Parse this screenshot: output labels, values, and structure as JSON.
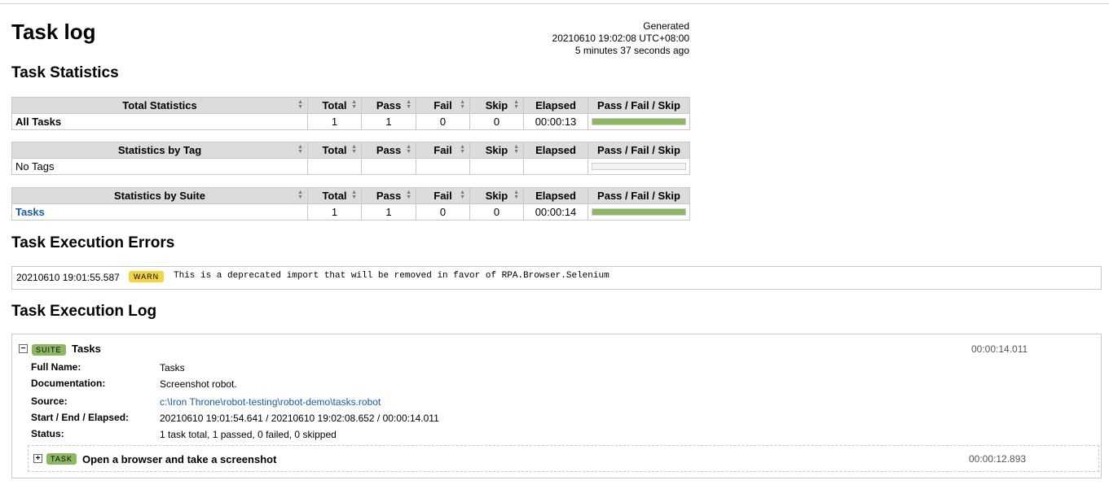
{
  "page": {
    "title": "Task log",
    "generated_label": "Generated",
    "generated_time": "20210610 19:02:08 UTC+08:00",
    "generated_ago": "5 minutes 37 seconds ago"
  },
  "statistics": {
    "title": "Task Statistics",
    "columns": [
      "Total",
      "Pass",
      "Fail",
      "Skip",
      "Elapsed",
      "Pass / Fail / Skip"
    ],
    "total": {
      "header": "Total Statistics",
      "row": {
        "name": "All Tasks",
        "total": "1",
        "pass": "1",
        "fail": "0",
        "skip": "0",
        "elapsed": "00:00:13",
        "pass_fraction": 1
      }
    },
    "tag": {
      "header": "Statistics by Tag",
      "row": {
        "name": "No Tags",
        "total": "",
        "pass": "",
        "fail": "",
        "skip": "",
        "elapsed": "",
        "pass_fraction": 0
      }
    },
    "suite": {
      "header": "Statistics by Suite",
      "row": {
        "name": "Tasks",
        "total": "1",
        "pass": "1",
        "fail": "0",
        "skip": "0",
        "elapsed": "00:00:14",
        "pass_fraction": 1
      }
    }
  },
  "errors": {
    "title": "Task Execution Errors",
    "items": [
      {
        "timestamp": "20210610 19:01:55.587",
        "level": "WARN",
        "message": "This is a deprecated import that will be removed in favor of RPA.Browser.Selenium"
      }
    ]
  },
  "log": {
    "title": "Task Execution Log",
    "suite": {
      "badge": "SUITE",
      "name": "Tasks",
      "elapsed": "00:00:14.011",
      "toggle": "−",
      "meta": [
        {
          "label": "Full Name:",
          "value": "Tasks"
        },
        {
          "label": "Documentation:",
          "value": "Screenshot robot."
        },
        {
          "label": "Source:",
          "value": "c:\\Iron Throne\\robot-testing\\robot-demo\\tasks.robot"
        },
        {
          "label": "Start / End / Elapsed:",
          "value": "20210610 19:01:54.641 / 20210610 19:02:08.652 / 00:00:14.011"
        },
        {
          "label": "Status:",
          "value": "1 task total, 1 passed, 0 failed, 0 skipped"
        }
      ]
    },
    "task": {
      "badge": "TASK",
      "name": "Open a browser and take a screenshot",
      "elapsed": "00:00:12.893",
      "toggle": "+"
    }
  },
  "colors": {
    "pass": "#8cb760",
    "warn": "#f5d442",
    "link": "#1a5aa6",
    "header_bg": "#dcdcdc"
  }
}
